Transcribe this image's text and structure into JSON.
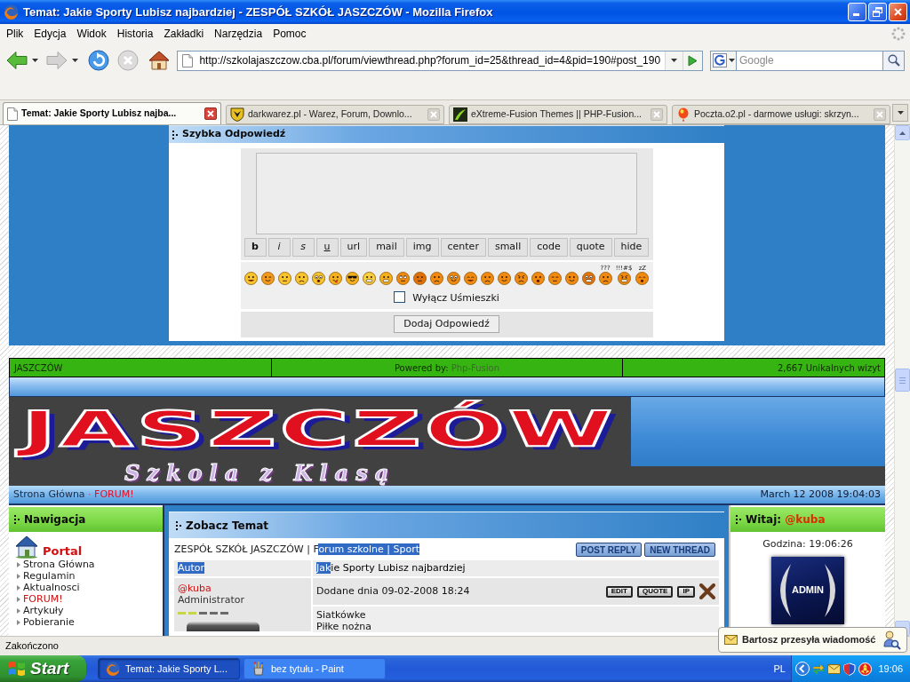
{
  "window": {
    "title": "Temat: Jakie Sporty Lubisz najbardziej - ZESPÓŁ SZKÓŁ JASZCZÓW - Mozilla Firefox"
  },
  "menu": [
    "Plik",
    "Edycja",
    "Widok",
    "Historia",
    "Zakładki",
    "Narzędzia",
    "Pomoc"
  ],
  "toolbar": {
    "url": "http://szkolajaszczow.cba.pl/forum/viewthread.php?forum_id=25&thread_id=4&pid=190#post_190",
    "search_placeholder": "Google"
  },
  "tabs": [
    {
      "label": "Temat: Jakie Sporty Lubisz najba...",
      "selected": true
    },
    {
      "label": "darkwarez.pl - Warez, Forum, Downlo...",
      "selected": false
    },
    {
      "label": "eXtreme-Fusion Themes || PHP-Fusion...",
      "selected": false
    },
    {
      "label": "Poczta.o2.pl - darmowe usługi: skrzyn...",
      "selected": false
    }
  ],
  "page": {
    "quick_reply": {
      "title": "Szybka Odpowiedź",
      "format_buttons": [
        {
          "label": "b",
          "kind": "bold"
        },
        {
          "label": "i",
          "kind": "italic"
        },
        {
          "label": "s",
          "kind": "italic"
        },
        {
          "label": "u",
          "kind": "underline"
        },
        {
          "label": "url",
          "kind": "plain"
        },
        {
          "label": "mail",
          "kind": "plain"
        },
        {
          "label": "img",
          "kind": "plain"
        },
        {
          "label": "center",
          "kind": "plain"
        },
        {
          "label": "small",
          "kind": "plain"
        },
        {
          "label": "code",
          "kind": "plain"
        },
        {
          "label": "quote",
          "kind": "plain"
        },
        {
          "label": "hide",
          "kind": "plain"
        }
      ],
      "smileys": [
        {
          "kind": "smile"
        },
        {
          "kind": "wink"
        },
        {
          "kind": "neutral"
        },
        {
          "kind": "sad"
        },
        {
          "kind": "shocked"
        },
        {
          "kind": "tongue"
        },
        {
          "kind": "cool"
        },
        {
          "kind": "grin"
        },
        {
          "kind": "grimace"
        },
        {
          "kind": "rolleyes"
        },
        {
          "kind": "dizzy"
        },
        {
          "kind": "unsure"
        },
        {
          "kind": "eek"
        },
        {
          "kind": "laugh"
        },
        {
          "kind": "squint"
        },
        {
          "kind": "happy"
        },
        {
          "kind": "angry"
        },
        {
          "kind": "surprised"
        },
        {
          "kind": "flat"
        },
        {
          "kind": "content"
        },
        {
          "kind": "crazy"
        },
        {
          "kind": "confused",
          "caption": "???"
        },
        {
          "kind": "swearing",
          "caption": "!!!#$"
        },
        {
          "kind": "sleepy",
          "caption": "zZ"
        }
      ],
      "disable_smileys": {
        "label": "Wyłącz Uśmieszki",
        "checked": false
      },
      "submit": "Dodaj Odpowiedź"
    },
    "footer": {
      "site": "JASZCZÓW",
      "powered_by": "Powered by:",
      "engine": "Php-Fusion",
      "visits": "2,667 Unikalnych wizyt"
    },
    "banner": {
      "logo": "JASZCZÓW",
      "slogan": "Szkola z Klasą"
    },
    "breadcrumb_bar": {
      "links": [
        {
          "label": "Strona Główna",
          "selected": false
        },
        {
          "label": "FORUM!",
          "selected": true
        }
      ],
      "separator": "·",
      "datetime": "March 12 2008 19:04:03"
    },
    "sidebar_left": {
      "title": "Nawigacja",
      "section": "Portal",
      "items": [
        {
          "label": "Strona Główna",
          "selected": false
        },
        {
          "label": "Regulamin",
          "selected": false
        },
        {
          "label": "Aktualnosci",
          "selected": false
        },
        {
          "label": "FORUM!",
          "selected": true
        },
        {
          "label": "Artykuły",
          "selected": false
        },
        {
          "label": "Pobieranie",
          "selected": false
        }
      ]
    },
    "thread": {
      "title": "Zobacz Temat",
      "path": [
        {
          "text": "ZESPÓŁ SZKÓŁ JASZCZÓW | F",
          "highlighted": false
        },
        {
          "text": "orum szkolne | Sport",
          "highlighted": true
        }
      ],
      "buttons": [
        "POST REPLY",
        "NEW THREAD"
      ],
      "author_header": [
        {
          "text": "Autor",
          "highlighted": true
        }
      ],
      "subject": [
        {
          "text": "Jak",
          "highlighted": true
        },
        {
          "text": "ie Sporty Lubisz najbardziej",
          "highlighted": false
        }
      ],
      "post": {
        "author": "@kuba",
        "role": "Administrator",
        "stars": 2,
        "date": "Dodane dnia 09-02-2008 18:24",
        "actions": [
          "EDIT",
          "QUOTE",
          "IP"
        ],
        "body": [
          "Siatkówke",
          "Piłke nożna"
        ]
      }
    },
    "sidebar_right": {
      "greeting": "Witaj:",
      "user": "@kuba",
      "time": "Godzina: 19:06:26",
      "avatar_label": "ADMIN"
    }
  },
  "status_bar": {
    "text": "Zakończono"
  },
  "notification": {
    "text": "Bartosz przesyła wiadomość"
  },
  "taskbar": {
    "start": "Start",
    "buttons": [
      {
        "label": "Temat: Jakie Sporty L...",
        "selected": true
      },
      {
        "label": "bez tytułu - Paint",
        "selected": false
      }
    ],
    "language": "PL",
    "clock": "19:06"
  }
}
